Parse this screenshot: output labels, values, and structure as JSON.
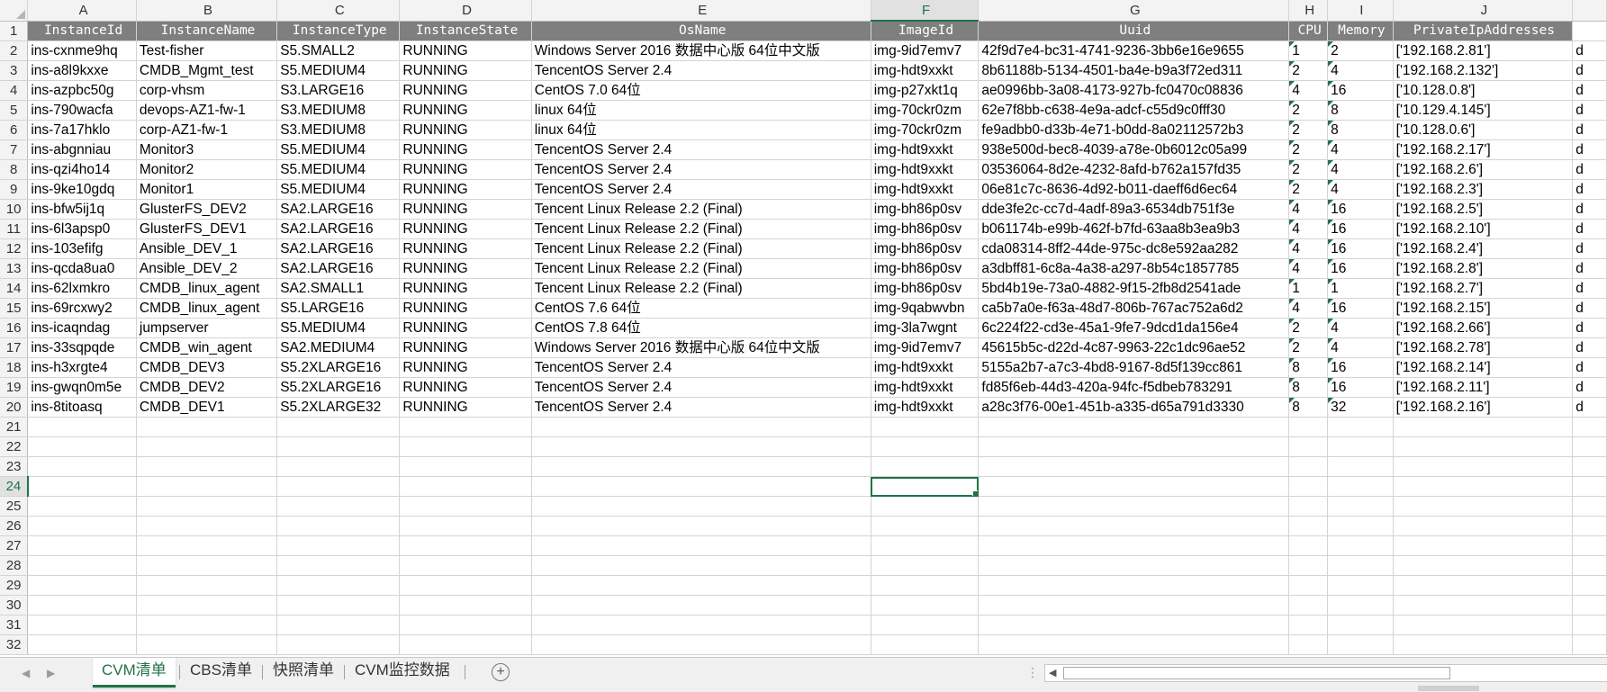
{
  "columns": [
    "",
    "A",
    "B",
    "C",
    "D",
    "E",
    "F",
    "G",
    "H",
    "I",
    "J",
    ""
  ],
  "header": [
    "InstanceId",
    "InstanceName",
    "InstanceType",
    "InstanceState",
    "OsName",
    "ImageId",
    "Uuid",
    "CPU",
    "Memory",
    "PrivateIpAddresses",
    ""
  ],
  "rows": [
    [
      "ins-cxnme9hq",
      "Test-fisher",
      "S5.SMALL2",
      "RUNNING",
      "Windows Server 2016 数据中心版 64位中文版",
      "img-9id7emv7",
      "42f9d7e4-bc31-4741-9236-3bb6e16e9655",
      "1",
      "2",
      "['192.168.2.81']",
      "d"
    ],
    [
      "ins-a8l9kxxe",
      "CMDB_Mgmt_test",
      "S5.MEDIUM4",
      "RUNNING",
      "TencentOS Server 2.4",
      "img-hdt9xxkt",
      "8b61188b-5134-4501-ba4e-b9a3f72ed311",
      "2",
      "4",
      "['192.168.2.132']",
      "d"
    ],
    [
      "ins-azpbc50g",
      "corp-vhsm",
      "S3.LARGE16",
      "RUNNING",
      "CentOS 7.0 64位",
      "img-p27xkt1q",
      "ae0996bb-3a08-4173-927b-fc0470c08836",
      "4",
      "16",
      "['10.128.0.8']",
      "d"
    ],
    [
      "ins-790wacfa",
      "devops-AZ1-fw-1",
      "S3.MEDIUM8",
      "RUNNING",
      "linux 64位",
      "img-70ckr0zm",
      "62e7f8bb-c638-4e9a-adcf-c55d9c0fff30",
      "2",
      "8",
      "['10.129.4.145']",
      "d"
    ],
    [
      "ins-7a17hklo",
      "corp-AZ1-fw-1",
      "S3.MEDIUM8",
      "RUNNING",
      "linux 64位",
      "img-70ckr0zm",
      "fe9adbb0-d33b-4e71-b0dd-8a02112572b3",
      "2",
      "8",
      "['10.128.0.6']",
      "d"
    ],
    [
      "ins-abgnniau",
      "Monitor3",
      "S5.MEDIUM4",
      "RUNNING",
      "TencentOS Server 2.4",
      "img-hdt9xxkt",
      "938e500d-bec8-4039-a78e-0b6012c05a99",
      "2",
      "4",
      "['192.168.2.17']",
      "d"
    ],
    [
      "ins-qzi4ho14",
      "Monitor2",
      "S5.MEDIUM4",
      "RUNNING",
      "TencentOS Server 2.4",
      "img-hdt9xxkt",
      "03536064-8d2e-4232-8afd-b762a157fd35",
      "2",
      "4",
      "['192.168.2.6']",
      "d"
    ],
    [
      "ins-9ke10gdq",
      "Monitor1",
      "S5.MEDIUM4",
      "RUNNING",
      "TencentOS Server 2.4",
      "img-hdt9xxkt",
      "06e81c7c-8636-4d92-b011-daeff6d6ec64",
      "2",
      "4",
      "['192.168.2.3']",
      "d"
    ],
    [
      "ins-bfw5ij1q",
      "GlusterFS_DEV2",
      "SA2.LARGE16",
      "RUNNING",
      "Tencent Linux Release 2.2 (Final)",
      "img-bh86p0sv",
      "dde3fe2c-cc7d-4adf-89a3-6534db751f3e",
      "4",
      "16",
      "['192.168.2.5']",
      "d"
    ],
    [
      "ins-6l3apsp0",
      "GlusterFS_DEV1",
      "SA2.LARGE16",
      "RUNNING",
      "Tencent Linux Release 2.2 (Final)",
      "img-bh86p0sv",
      "b061174b-e99b-462f-b7fd-63aa8b3ea9b3",
      "4",
      "16",
      "['192.168.2.10']",
      "d"
    ],
    [
      "ins-103efifg",
      "Ansible_DEV_1",
      "SA2.LARGE16",
      "RUNNING",
      "Tencent Linux Release 2.2 (Final)",
      "img-bh86p0sv",
      "cda08314-8ff2-44de-975c-dc8e592aa282",
      "4",
      "16",
      "['192.168.2.4']",
      "d"
    ],
    [
      "ins-qcda8ua0",
      "Ansible_DEV_2",
      "SA2.LARGE16",
      "RUNNING",
      "Tencent Linux Release 2.2 (Final)",
      "img-bh86p0sv",
      "a3dbff81-6c8a-4a38-a297-8b54c1857785",
      "4",
      "16",
      "['192.168.2.8']",
      "d"
    ],
    [
      "ins-62lxmkro",
      "CMDB_linux_agent",
      "SA2.SMALL1",
      "RUNNING",
      "Tencent Linux Release 2.2 (Final)",
      "img-bh86p0sv",
      "5bd4b19e-73a0-4882-9f15-2fb8d2541ade",
      "1",
      "1",
      "['192.168.2.7']",
      "d"
    ],
    [
      "ins-69rcxwy2",
      "CMDB_linux_agent",
      "S5.LARGE16",
      "RUNNING",
      "CentOS 7.6 64位",
      "img-9qabwvbn",
      "ca5b7a0e-f63a-48d7-806b-767ac752a6d2",
      "4",
      "16",
      "['192.168.2.15']",
      "d"
    ],
    [
      "ins-icaqndag",
      "jumpserver",
      "S5.MEDIUM4",
      "RUNNING",
      "CentOS 7.8 64位",
      "img-3la7wgnt",
      "6c224f22-cd3e-45a1-9fe7-9dcd1da156e4",
      "2",
      "4",
      "['192.168.2.66']",
      "d"
    ],
    [
      "ins-33sqpqde",
      "CMDB_win_agent",
      "SA2.MEDIUM4",
      "RUNNING",
      "Windows Server 2016 数据中心版 64位中文版",
      "img-9id7emv7",
      "45615b5c-d22d-4c87-9963-22c1dc96ae52",
      "2",
      "4",
      "['192.168.2.78']",
      "d"
    ],
    [
      "ins-h3xrgte4",
      "CMDB_DEV3",
      "S5.2XLARGE16",
      "RUNNING",
      "TencentOS Server 2.4",
      "img-hdt9xxkt",
      "5155a2b7-a7c3-4bd8-9167-8d5f139cc861",
      "8",
      "16",
      "['192.168.2.14']",
      "d"
    ],
    [
      "ins-gwqn0m5e",
      "CMDB_DEV2",
      "S5.2XLARGE16",
      "RUNNING",
      "TencentOS Server 2.4",
      "img-hdt9xxkt",
      "fd85f6eb-44d3-420a-94fc-f5dbeb783291",
      "8",
      "16",
      "['192.168.2.11']",
      "d"
    ],
    [
      "ins-8titoasq",
      "CMDB_DEV1",
      "S5.2XLARGE32",
      "RUNNING",
      "TencentOS Server 2.4",
      "img-hdt9xxkt",
      "a28c3f76-00e1-451b-a335-d65a791d3330",
      "8",
      "32",
      "['192.168.2.16']",
      "d"
    ]
  ],
  "empty_row_numbers": [
    "21",
    "22",
    "23",
    "24",
    "25",
    "26",
    "27",
    "28",
    "29",
    "30",
    "31",
    "32"
  ],
  "selected_cell": {
    "column": "F",
    "row": "24"
  },
  "sheet_tabs": [
    "CVM清单",
    "CBS清单",
    "快照清单",
    "CVM监控数据"
  ],
  "active_tab": "CVM清单",
  "icons": {
    "add_sheet": "plus-circle-icon",
    "nav_prev": "triangle-left-icon",
    "nav_next": "triangle-right-icon"
  },
  "colors": {
    "accent": "#217346",
    "header_fill": "#7f7f7f",
    "header_text": "#ffffff"
  }
}
